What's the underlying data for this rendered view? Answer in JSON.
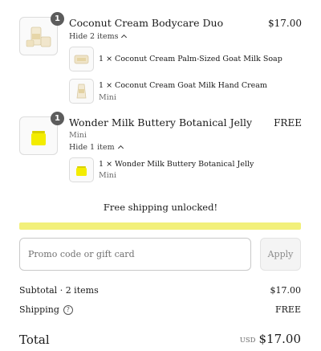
{
  "items": [
    {
      "title": "Coconut Cream Bodycare Duo",
      "price": "$17.00",
      "quantity": "1",
      "toggle_label": "Hide 2 items",
      "sub_items": [
        {
          "title": "1 × Coconut Cream Palm-Sized Goat Milk Soap"
        },
        {
          "title": "1 × Coconut Cream Goat Milk Hand Cream",
          "variant": "Mini"
        }
      ]
    },
    {
      "title": "Wonder Milk Buttery Botanical Jelly",
      "price": "FREE",
      "quantity": "1",
      "variant": "Mini",
      "toggle_label": "Hide 1 item",
      "sub_items": [
        {
          "title": "1 × Wonder Milk Buttery Botanical Jelly",
          "variant": "Mini"
        }
      ]
    }
  ],
  "shipping_progress": {
    "message": "Free shipping unlocked!",
    "percent": 100,
    "bar_color": "#f2f07a"
  },
  "discount": {
    "placeholder": "Promo code or gift card",
    "value": "",
    "apply_label": "Apply"
  },
  "summary": {
    "subtotal_label": "Subtotal · 2 items",
    "subtotal_value": "$17.00",
    "shipping_label": "Shipping",
    "shipping_value": "FREE",
    "total_label": "Total",
    "currency": "USD",
    "total_value": "$17.00"
  }
}
